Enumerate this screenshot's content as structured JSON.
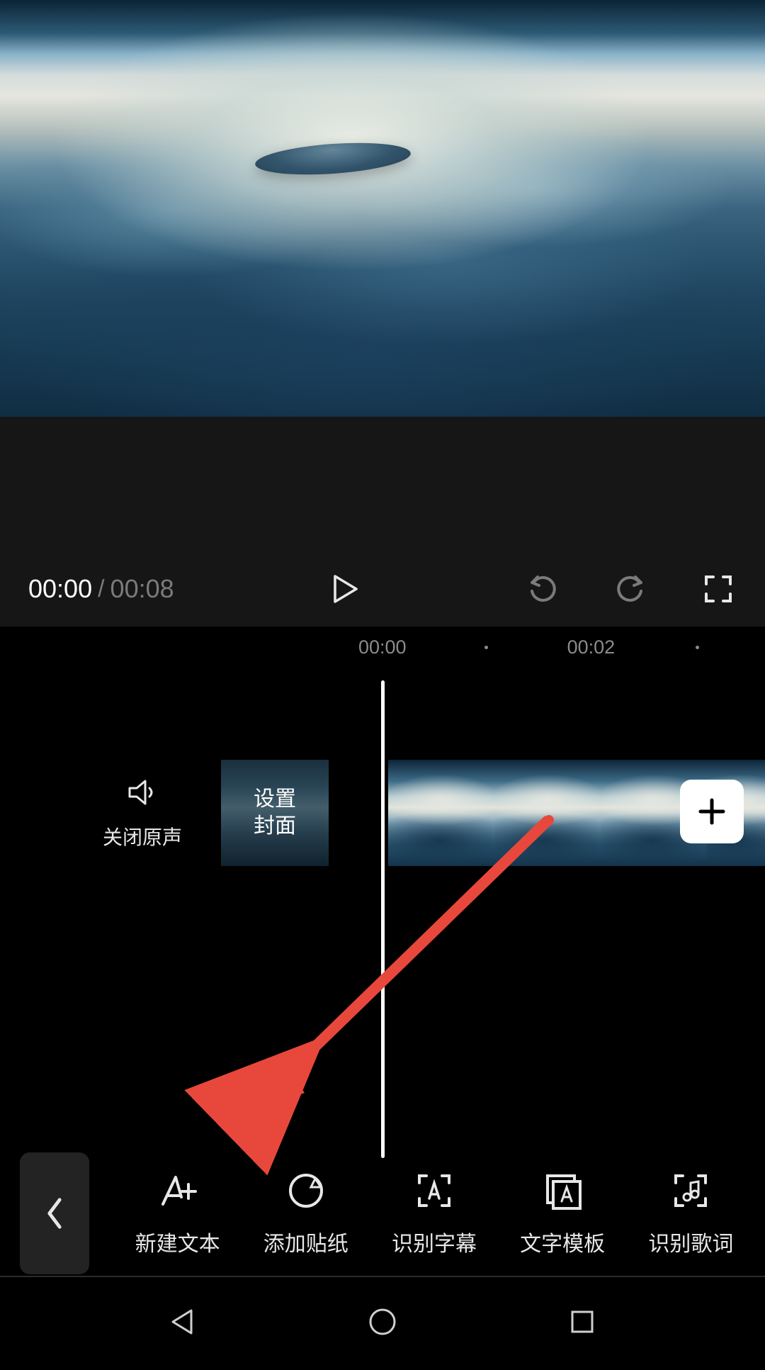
{
  "playback": {
    "current": "00:00",
    "separator": "/",
    "total": "00:08"
  },
  "timeline": {
    "tick1": "00:00",
    "tick2": "00:02",
    "mute_label": "关闭原声",
    "cover_line1": "设置",
    "cover_line2": "封面"
  },
  "toolbar": {
    "items": [
      {
        "label": "新建文本",
        "icon": "text-plus-icon"
      },
      {
        "label": "添加贴纸",
        "icon": "sticker-icon"
      },
      {
        "label": "识别字幕",
        "icon": "subtitle-scan-icon"
      },
      {
        "label": "文字模板",
        "icon": "text-template-icon"
      },
      {
        "label": "识别歌词",
        "icon": "lyrics-scan-icon"
      }
    ]
  },
  "colors": {
    "arrow": "#e8483b",
    "accent_white": "#ffffff",
    "text_muted": "#7b7b7b"
  }
}
